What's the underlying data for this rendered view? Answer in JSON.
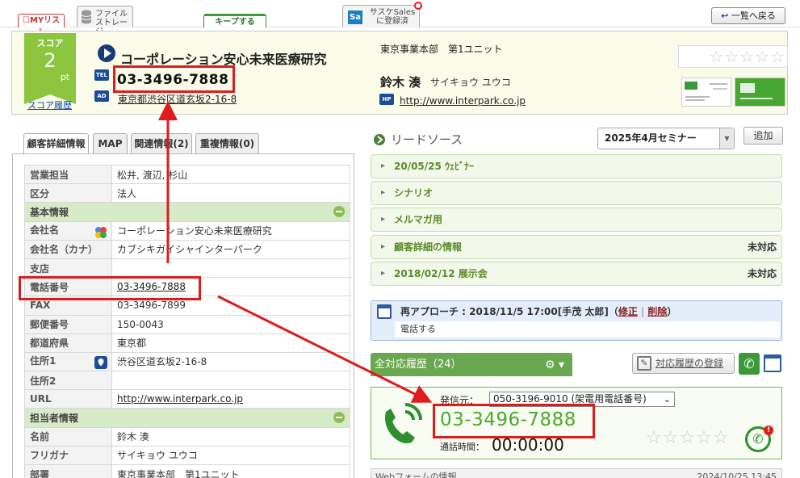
{
  "top_tabs": {
    "mylist": "☐MYリスト",
    "file_storage_line1": "ファイル",
    "file_storage_line2": "ストレージ",
    "keep": "キープする",
    "sasuke_line1": "サスケSales",
    "sasuke_line2": "に登録済",
    "sasuke_logo": "Sa",
    "back": "一覧へ戻る"
  },
  "header": {
    "score_label": "スコア",
    "score_value": "2",
    "score_unit": "pt",
    "score_history": "スコア履歴",
    "company_name": "コーポレーション安心未来医療研究",
    "tel_tag": "TEL",
    "tel": "03-3496-7888",
    "ad_tag": "AD",
    "address": "東京都渋谷区道玄坂2-16-8",
    "department": "東京事業本部　第1ユニット",
    "person_name": "鈴木 湊",
    "person_kana": "サイキョウ ユウコ",
    "hp_tag": "HP",
    "homepage": "http://www.interpark.co.jp",
    "stars": "☆☆☆☆☆",
    "rating": 0
  },
  "left_tabs": [
    "顧客詳細情報",
    "MAP",
    "関連情報(2)",
    "重複情報(0)"
  ],
  "detail_rows": [
    {
      "k": "営業担当",
      "v": "松井, 渡辺, 杉山"
    },
    {
      "k": "区分",
      "v": "法人"
    },
    {
      "section": "基本情報"
    },
    {
      "k": "会社名",
      "v": "コーポレーション安心未来医療研究"
    },
    {
      "k": "会社名（カナ）",
      "v": "カブシキガイシャインターパーク"
    },
    {
      "k": "支店",
      "v": ""
    },
    {
      "k": "電話番号",
      "v": "03-3496-7888"
    },
    {
      "k": "FAX",
      "v": "03-3496-7899"
    },
    {
      "k": "郵便番号",
      "v": "150-0043"
    },
    {
      "k": "都道府県",
      "v": "東京都"
    },
    {
      "k": "住所1",
      "v": "渋谷区道玄坂2-16-8"
    },
    {
      "k": "住所2",
      "v": ""
    },
    {
      "k": "URL",
      "v": "http://www.interpark.co.jp"
    },
    {
      "section": "担当者情報"
    },
    {
      "k": "名前",
      "v": "鈴木 湊"
    },
    {
      "k": "フリガナ",
      "v": "サイキョウ ユウコ"
    },
    {
      "k": "部署",
      "v": "東京事業本部　第1ユニット"
    }
  ],
  "lead_source": {
    "title": "リードソース",
    "selected": "2025年4月セミナー",
    "add": "追加",
    "items": [
      {
        "label": "20/05/25 ｳｪﾋﾞﾅｰ",
        "status": ""
      },
      {
        "label": "シナリオ",
        "status": ""
      },
      {
        "label": "メルマガ用",
        "status": ""
      },
      {
        "label": "顧客詳細の情報",
        "status": "未対応"
      },
      {
        "label": "2018/02/12 展示会",
        "status": "未対応"
      }
    ]
  },
  "reapproach": {
    "text": "再アプローチ : 2018/11/5 17:00[手茂 太郎]（",
    "edit": "修正",
    "sep": "|",
    "delete": "削除",
    "close": "）",
    "note": "電話する"
  },
  "history": {
    "tab": "全対応履歴（24）",
    "register": "対応履歴の登録"
  },
  "call": {
    "caller_label": "発信元：",
    "caller_option": "050-3196-9010 (架電用電話番号)",
    "number": "03-3496-7888",
    "time_label": "通話時間：",
    "time": "00:00:00",
    "stars": "☆☆☆☆☆",
    "rating": 0
  },
  "web_form": {
    "label": "Webフォームの情報",
    "date": "2024/10/25 13:45"
  }
}
